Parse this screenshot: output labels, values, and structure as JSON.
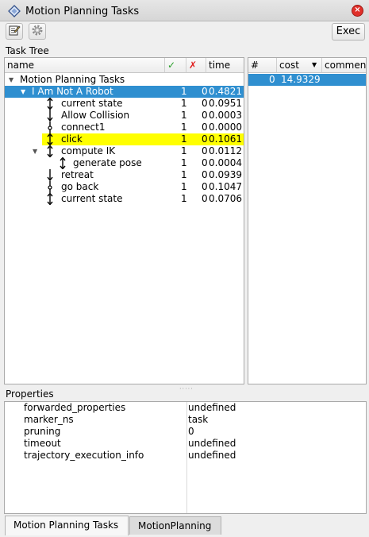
{
  "window": {
    "title": "Motion Planning Tasks",
    "close_glyph": "×"
  },
  "toolbar": {
    "exec_label": "Exec"
  },
  "task_tree": {
    "label": "Task Tree",
    "columns": {
      "name": "name",
      "ok": "✓",
      "fail": "✗",
      "time": "time"
    },
    "rows": [
      {
        "name": "Motion Planning Tasks",
        "ok": "",
        "fail": "",
        "time": "",
        "expand": "▼",
        "icon": ""
      },
      {
        "name": "I Am Not A Robot",
        "ok": "1",
        "fail": "0",
        "time": "0.4821",
        "expand": "▼",
        "icon": ""
      },
      {
        "name": "current state",
        "ok": "1",
        "fail": "0",
        "time": "0.0951",
        "expand": "",
        "icon": "generator-icon"
      },
      {
        "name": "Allow Collision",
        "ok": "1",
        "fail": "0",
        "time": "0.0003",
        "expand": "",
        "icon": "propagator-icon"
      },
      {
        "name": "connect1",
        "ok": "1",
        "fail": "0",
        "time": "0.0000",
        "expand": "",
        "icon": "connector-icon"
      },
      {
        "name": "click",
        "ok": "1",
        "fail": "0",
        "time": "0.1061",
        "expand": "",
        "icon": "propagator-icon"
      },
      {
        "name": "compute IK",
        "ok": "1",
        "fail": "0",
        "time": "0.0112",
        "expand": "▼",
        "icon": "propagator-icon"
      },
      {
        "name": "generate pose",
        "ok": "1",
        "fail": "0",
        "time": "0.0004",
        "expand": "",
        "icon": "propagator-icon"
      },
      {
        "name": "retreat",
        "ok": "1",
        "fail": "0",
        "time": "0.0939",
        "expand": "",
        "icon": "generator-icon"
      },
      {
        "name": "go back",
        "ok": "1",
        "fail": "0",
        "time": "0.1047",
        "expand": "",
        "icon": "connector-icon"
      },
      {
        "name": "current state",
        "ok": "1",
        "fail": "0",
        "time": "0.0706",
        "expand": "",
        "icon": "generator-icon"
      }
    ]
  },
  "solutions": {
    "columns": {
      "id": "#",
      "cost": "cost",
      "comment": "commen"
    },
    "sort_indicator": "▼",
    "rows": [
      {
        "id": "0",
        "cost": "14.9329",
        "comment": ""
      }
    ]
  },
  "properties": {
    "label": "Properties",
    "rows": [
      {
        "key": "forwarded_properties",
        "value": "undefined"
      },
      {
        "key": "marker_ns",
        "value": "task"
      },
      {
        "key": "pruning",
        "value": "0"
      },
      {
        "key": "timeout",
        "value": "undefined"
      },
      {
        "key": "trajectory_execution_info",
        "value": "undefined"
      }
    ]
  },
  "tabs": [
    {
      "label": "Motion Planning Tasks"
    },
    {
      "label": "MotionPlanning"
    }
  ],
  "colors": {
    "selection": "#2f8fd0",
    "highlight": "#ffff00",
    "ok_green": "#2aa02a",
    "fail_red": "#e02020"
  }
}
